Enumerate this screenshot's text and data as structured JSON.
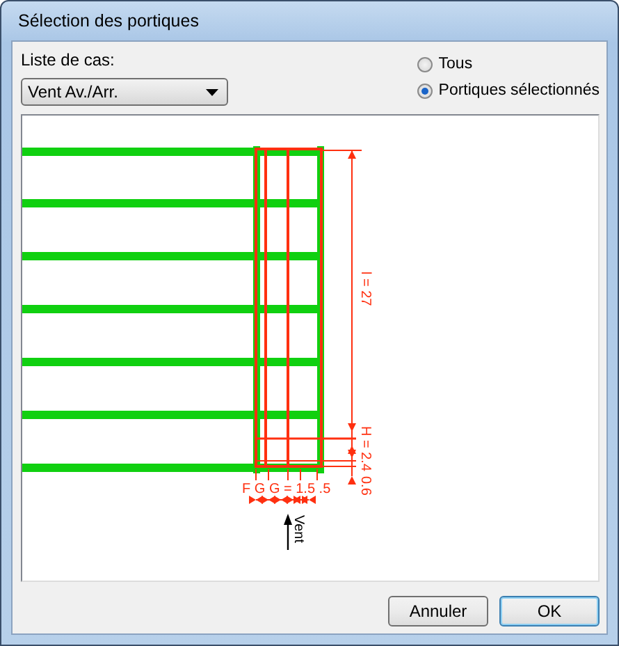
{
  "window": {
    "title": "Sélection des portiques"
  },
  "case_list": {
    "label": "Liste de cas:",
    "value": "Vent Av./Arr."
  },
  "options": [
    {
      "label": "Tous",
      "selected": false
    },
    {
      "label": "Portiques sélectionnés",
      "selected": true
    }
  ],
  "drawing": {
    "length_label": "l = 27",
    "height_label": "H = 2.4",
    "offset_label": "0.6",
    "spacing_label": "F G G = 1.5 .5",
    "wind_label": "Vent"
  },
  "buttons": [
    {
      "label": "Annuler",
      "default": false
    },
    {
      "label": "OK",
      "default": true
    }
  ]
}
